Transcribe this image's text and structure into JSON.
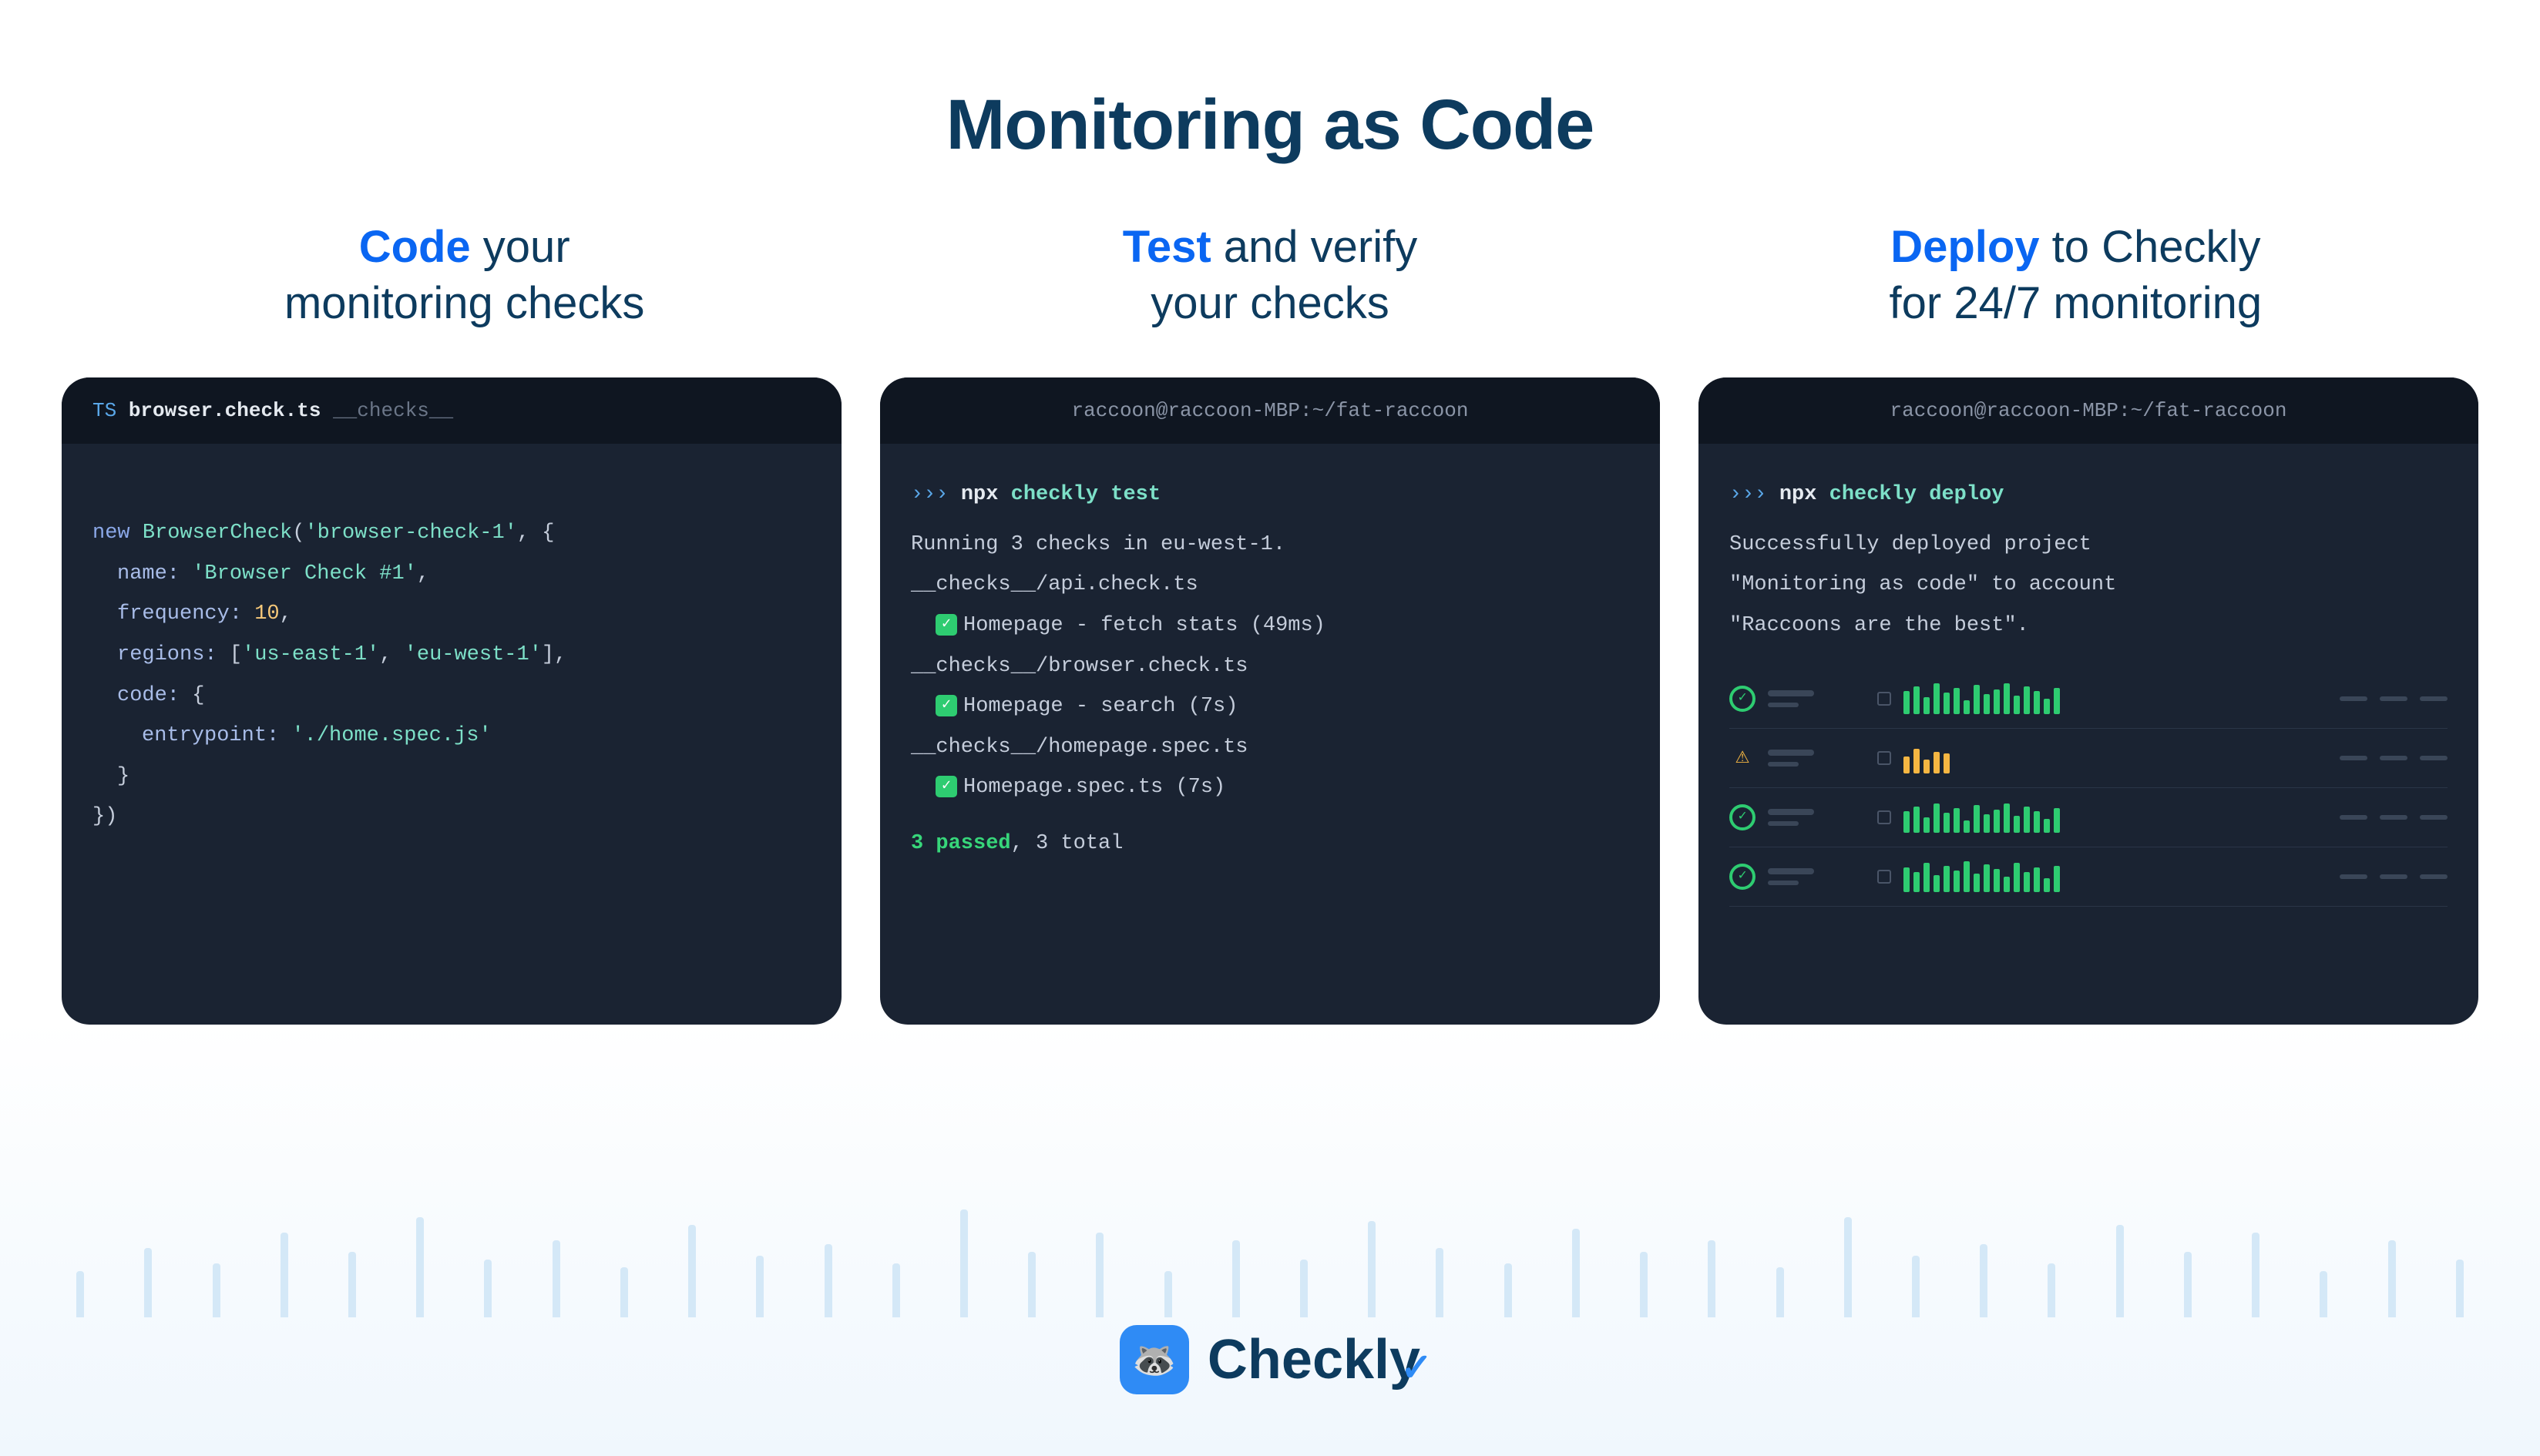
{
  "title": "Monitoring as Code",
  "subtitles": [
    {
      "highlight": "Code",
      "rest": " your",
      "line2": "monitoring checks"
    },
    {
      "highlight": "Test",
      "rest": " and verify",
      "line2": "your checks"
    },
    {
      "highlight": "Deploy",
      "rest": " to Checkly",
      "line2": "for 24/7 monitoring"
    }
  ],
  "card1": {
    "header_ts": "TS",
    "header_file": "browser.check.ts",
    "header_dir": "__checks__",
    "code": {
      "l1_new": "new",
      "l1_class": "BrowserCheck",
      "l1_arg": "'browser-check-1'",
      "l2_prop": "name:",
      "l2_val": "'Browser Check #1'",
      "l3_prop": "frequency:",
      "l3_val": "10",
      "l4_prop": "regions:",
      "l4_val1": "'us-east-1'",
      "l4_val2": "'eu-west-1'",
      "l5_prop": "code:",
      "l6_prop": "entrypoint:",
      "l6_val": "'./home.spec.js'"
    }
  },
  "card2": {
    "header": "raccoon@raccoon-MBP:~/fat-raccoon",
    "prompt": "›››",
    "npx": "npx",
    "cmd_checkly": "checkly",
    "cmd_test": "test",
    "running": "Running 3 checks in eu-west-1.",
    "f1": "__checks__/api.check.ts",
    "t1": "Homepage - fetch stats (49ms)",
    "f2": "__checks__/browser.check.ts",
    "t2": "Homepage - search (7s)",
    "f3": "__checks__/homepage.spec.ts",
    "t3": "Homepage.spec.ts (7s)",
    "passed": "3 passed",
    "total": ", 3 total"
  },
  "card3": {
    "header": "raccoon@raccoon-MBP:~/fat-raccoon",
    "prompt": "›››",
    "npx": "npx",
    "cmd_checkly": "checkly",
    "cmd_deploy": "deploy",
    "msg1": "Successfully deployed project",
    "msg2": "\"Monitoring as code\" to account",
    "msg3": "\"Raccoons are the best\"."
  },
  "brand": "Checkly",
  "bg_bars": [
    60,
    90,
    70,
    110,
    85,
    130,
    75,
    100,
    65,
    120,
    80,
    95,
    70,
    140,
    85,
    110,
    60,
    100,
    75,
    125,
    90,
    70,
    115,
    85,
    100,
    65,
    130,
    80,
    95,
    70,
    120,
    85,
    110,
    60,
    100,
    75
  ],
  "dash_rows": [
    {
      "status": "ok",
      "bars": "green",
      "heights": [
        30,
        36,
        22,
        40,
        28,
        34,
        18,
        38,
        26,
        32,
        40,
        24,
        36,
        30,
        20,
        34
      ]
    },
    {
      "status": "warn",
      "bars": "orange",
      "heights": [
        22,
        32,
        18,
        28,
        26
      ]
    },
    {
      "status": "ok",
      "bars": "green",
      "heights": [
        28,
        34,
        20,
        38,
        26,
        32,
        16,
        36,
        24,
        30,
        38,
        22,
        34,
        28,
        18,
        32
      ]
    },
    {
      "status": "ok",
      "bars": "green",
      "heights": [
        32,
        26,
        38,
        22,
        34,
        28,
        40,
        24,
        36,
        30,
        20,
        38,
        26,
        32,
        18,
        34
      ]
    }
  ]
}
